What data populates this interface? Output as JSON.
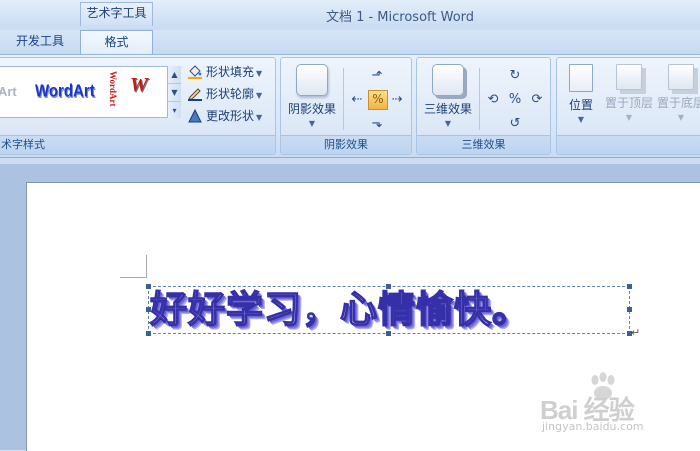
{
  "window": {
    "title": "文档 1 - Microsoft Word"
  },
  "context_tab_group": "艺术字工具",
  "tabs": [
    {
      "label": "开发工具"
    },
    {
      "label": "格式"
    }
  ],
  "ribbon": {
    "wordart_styles": {
      "label": "术字样式",
      "gallery": [
        "dArt",
        "WordArt",
        "WordArt",
        "W"
      ],
      "commands": [
        {
          "label": "形状填充",
          "icon": "paint-bucket-icon"
        },
        {
          "label": "形状轮廓",
          "icon": "pencil-outline-icon"
        },
        {
          "label": "更改形状",
          "icon": "triangle-shape-icon"
        }
      ]
    },
    "shadow_effects": {
      "label": "阴影效果",
      "button": "阴影效果"
    },
    "three_d_effects": {
      "label": "三维效果",
      "button": "三维效果"
    },
    "arrange": {
      "position": "位置",
      "bring_front": "置于顶层",
      "send_back": "置于底层"
    }
  },
  "document": {
    "wordart_text": "好好学习，心情愉快。",
    "paragraph_mark": "↵"
  },
  "watermark": {
    "brand": "Bai 经验",
    "url": "jingyan.baidu.com"
  },
  "colors": {
    "ribbon_text": "#15428b",
    "wordart_fill": "#d3d0ff",
    "wordart_outline": "#3530a8"
  }
}
